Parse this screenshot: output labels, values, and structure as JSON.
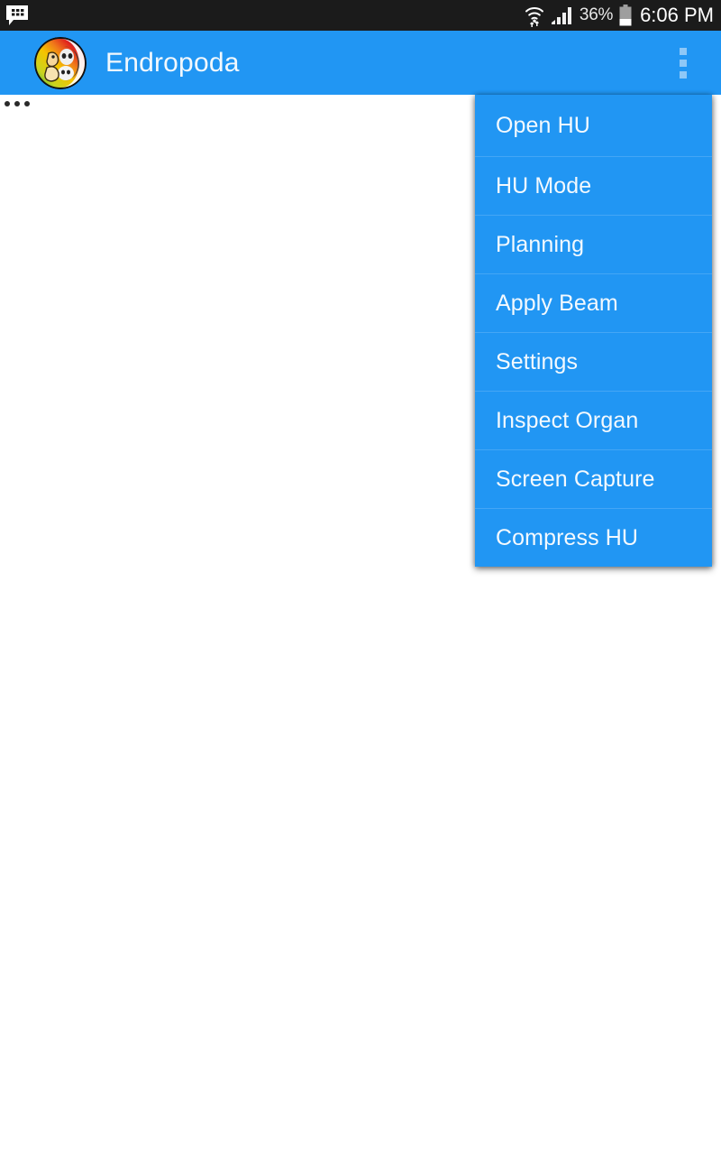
{
  "status_bar": {
    "notification_icon": "bbm-messenger-icon",
    "wifi_icon": "wifi-transfer-icon",
    "signal_icon": "cellular-signal-icon",
    "battery_percent": "36%",
    "battery_icon": "battery-icon",
    "time": "6:06 PM",
    "background_color": "#1b1b1b"
  },
  "app_bar": {
    "logo_icon": "app-logo-icon",
    "title": "Endropoda",
    "overflow_icon": "overflow-menu-icon",
    "background_color": "#2196f3"
  },
  "content": {
    "corner_indicator_icon": "three-dots-indicator"
  },
  "overflow_menu": {
    "visible": true,
    "background_color": "#2196f3",
    "items": [
      {
        "label": "Open HU"
      },
      {
        "label": "HU Mode"
      },
      {
        "label": "Planning"
      },
      {
        "label": "Apply Beam"
      },
      {
        "label": "Settings"
      },
      {
        "label": "Inspect Organ"
      },
      {
        "label": "Screen Capture"
      },
      {
        "label": "Compress HU"
      }
    ]
  }
}
